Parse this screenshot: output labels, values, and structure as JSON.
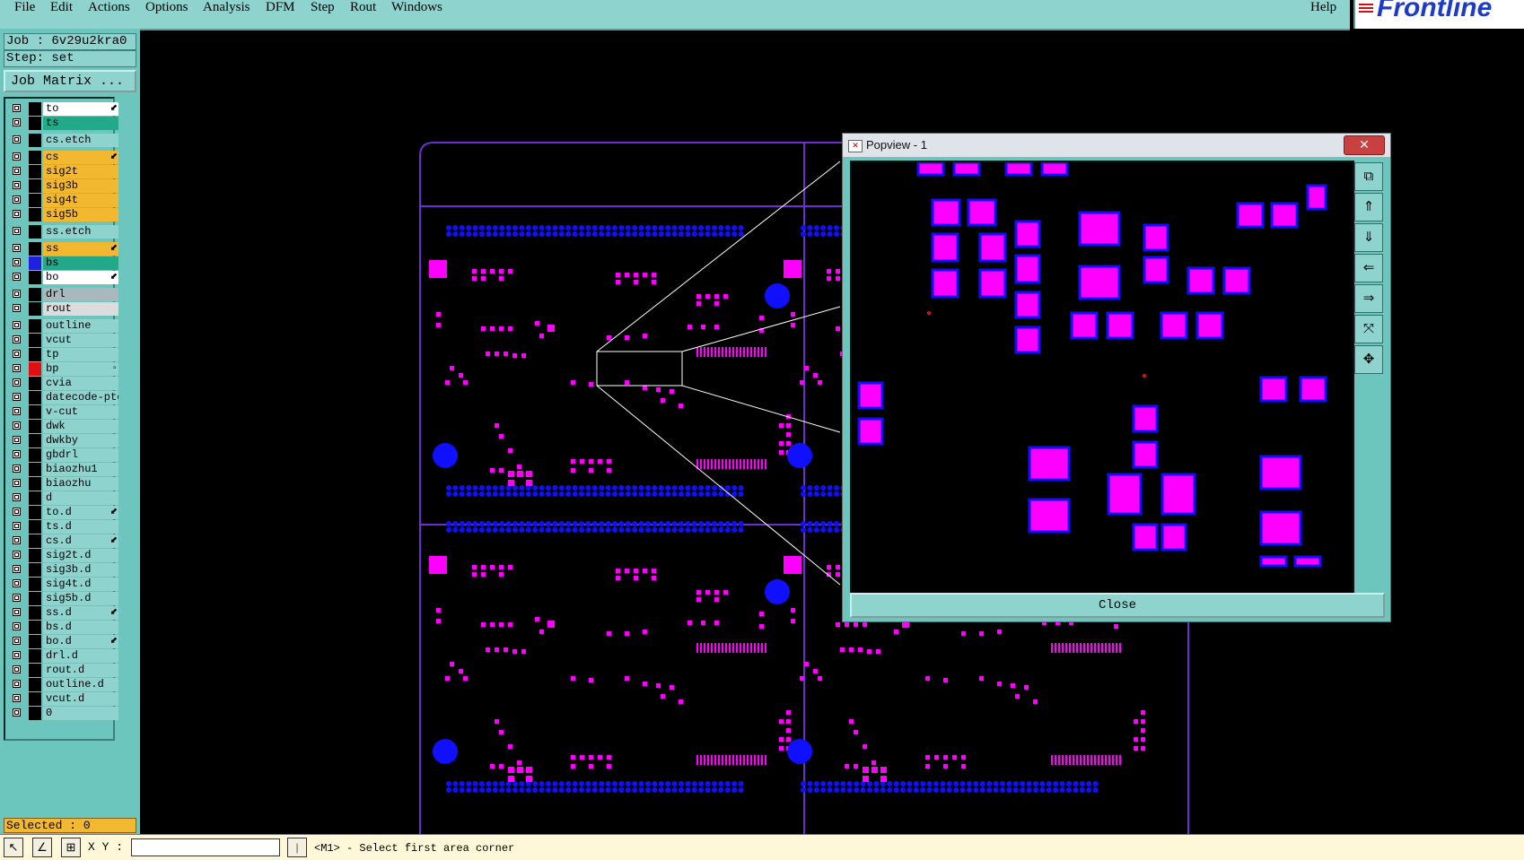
{
  "menu": {
    "items": [
      "File",
      "Edit",
      "Actions",
      "Options",
      "Analysis",
      "DFM",
      "Step",
      "Rout",
      "Windows"
    ],
    "help": "Help",
    "logo": "Frontline"
  },
  "job": {
    "job_label": "Job : 6v29u2kra0",
    "step_label": "Step: set",
    "matrix_button": "Job Matrix ..."
  },
  "layers": [
    {
      "name": "to",
      "color": "#ffffff",
      "swatch": "#000000",
      "arrow": "⬋"
    },
    {
      "name": "ts",
      "color": "#23a989",
      "swatch": "#000000",
      "arrow": ""
    },
    {
      "name": "cs.etch",
      "color": "#8fd3cf",
      "swatch": "#000000",
      "arrow": ""
    },
    {
      "name": "cs",
      "color": "#f2b830",
      "swatch": "#000000",
      "arrow": "⬋"
    },
    {
      "name": "sig2t",
      "color": "#f2b830",
      "swatch": "#000000",
      "arrow": ""
    },
    {
      "name": "sig3b",
      "color": "#f2b830",
      "swatch": "#000000",
      "arrow": ""
    },
    {
      "name": "sig4t",
      "color": "#f2b830",
      "swatch": "#000000",
      "arrow": ""
    },
    {
      "name": "sig5b",
      "color": "#f2b830",
      "swatch": "#000000",
      "arrow": ""
    },
    {
      "name": "ss.etch",
      "color": "#8fd3cf",
      "swatch": "#000000",
      "arrow": ""
    },
    {
      "name": "ss",
      "color": "#f2b830",
      "swatch": "#000000",
      "arrow": "⬋"
    },
    {
      "name": "bs",
      "color": "#23a989",
      "swatch": "#2020e0",
      "arrow": ""
    },
    {
      "name": "bo",
      "color": "#ffffff",
      "swatch": "#000000",
      "arrow": "⬋"
    },
    {
      "name": "drl",
      "color": "#a8b8bc",
      "swatch": "#000000",
      "arrow": ""
    },
    {
      "name": "rout",
      "color": "#dcdcdc",
      "swatch": "#000000",
      "arrow": ""
    },
    {
      "name": "outline",
      "color": "#8fd3cf",
      "swatch": "#000000",
      "arrow": ""
    },
    {
      "name": "vcut",
      "color": "#8fd3cf",
      "swatch": "#000000",
      "arrow": ""
    },
    {
      "name": "tp",
      "color": "#8fd3cf",
      "swatch": "#000000",
      "arrow": ""
    },
    {
      "name": "bp",
      "color": "#8fd3cf",
      "swatch": "#e01010",
      "arrow": "▫"
    },
    {
      "name": "cvia",
      "color": "#8fd3cf",
      "swatch": "#000000",
      "arrow": ""
    },
    {
      "name": "datecode-ptc",
      "color": "#8fd3cf",
      "swatch": "#000000",
      "arrow": ""
    },
    {
      "name": "v-cut",
      "color": "#8fd3cf",
      "swatch": "#000000",
      "arrow": ""
    },
    {
      "name": "dwk",
      "color": "#8fd3cf",
      "swatch": "#000000",
      "arrow": ""
    },
    {
      "name": "dwkby",
      "color": "#8fd3cf",
      "swatch": "#000000",
      "arrow": ""
    },
    {
      "name": "gbdrl",
      "color": "#8fd3cf",
      "swatch": "#000000",
      "arrow": ""
    },
    {
      "name": "biaozhu1",
      "color": "#8fd3cf",
      "swatch": "#000000",
      "arrow": ""
    },
    {
      "name": "biaozhu",
      "color": "#8fd3cf",
      "swatch": "#000000",
      "arrow": ""
    },
    {
      "name": "d",
      "color": "#8fd3cf",
      "swatch": "#000000",
      "arrow": ""
    },
    {
      "name": "to.d",
      "color": "#8fd3cf",
      "swatch": "#000000",
      "arrow": "⬋"
    },
    {
      "name": "ts.d",
      "color": "#8fd3cf",
      "swatch": "#000000",
      "arrow": ""
    },
    {
      "name": "cs.d",
      "color": "#8fd3cf",
      "swatch": "#000000",
      "arrow": "⬋"
    },
    {
      "name": "sig2t.d",
      "color": "#8fd3cf",
      "swatch": "#000000",
      "arrow": ""
    },
    {
      "name": "sig3b.d",
      "color": "#8fd3cf",
      "swatch": "#000000",
      "arrow": ""
    },
    {
      "name": "sig4t.d",
      "color": "#8fd3cf",
      "swatch": "#000000",
      "arrow": ""
    },
    {
      "name": "sig5b.d",
      "color": "#8fd3cf",
      "swatch": "#000000",
      "arrow": ""
    },
    {
      "name": "ss.d",
      "color": "#8fd3cf",
      "swatch": "#000000",
      "arrow": "⬋"
    },
    {
      "name": "bs.d",
      "color": "#8fd3cf",
      "swatch": "#000000",
      "arrow": ""
    },
    {
      "name": "bo.d",
      "color": "#8fd3cf",
      "swatch": "#000000",
      "arrow": "⬋"
    },
    {
      "name": "drl.d",
      "color": "#8fd3cf",
      "swatch": "#000000",
      "arrow": ""
    },
    {
      "name": "rout.d",
      "color": "#8fd3cf",
      "swatch": "#000000",
      "arrow": ""
    },
    {
      "name": "outline.d",
      "color": "#8fd3cf",
      "swatch": "#000000",
      "arrow": ""
    },
    {
      "name": "vcut.d",
      "color": "#8fd3cf",
      "swatch": "#000000",
      "arrow": ""
    },
    {
      "name": "0",
      "color": "#8fd3cf",
      "swatch": "#000000",
      "arrow": ""
    }
  ],
  "selected": "Selected : 0",
  "status": {
    "xy_label": "X Y :",
    "message": "<M1> - Select first area corner"
  },
  "popview": {
    "title": "Popview - 1",
    "close_x": "✕",
    "close_button": "Close"
  },
  "colors": {
    "pad": "#ff00ff",
    "via": "#1010ff",
    "board": "#6d2fd0"
  }
}
